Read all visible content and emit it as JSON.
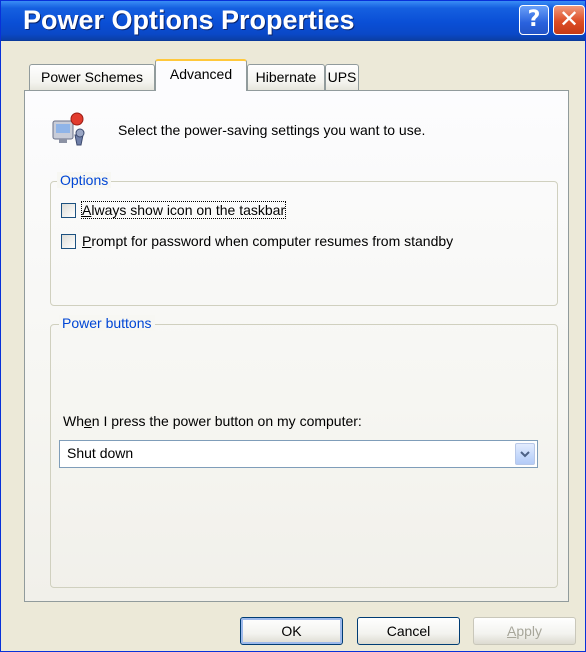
{
  "window": {
    "title": "Power Options Properties",
    "help_icon": "question-mark",
    "close_icon": "x"
  },
  "tabs": [
    {
      "label": "Power Schemes",
      "active": false
    },
    {
      "label": "Advanced",
      "active": true
    },
    {
      "label": "Hibernate",
      "active": false
    },
    {
      "label": "UPS",
      "active": false
    }
  ],
  "intro": {
    "icon": "power-options-icon",
    "text": "Select the power-saving settings you want to use."
  },
  "options_group": {
    "legend": "Options",
    "always_show_icon": {
      "access_key": "A",
      "rest": "lways show icon on the taskbar",
      "checked": false
    },
    "prompt_password": {
      "access_key": "P",
      "rest": "rompt for password when computer resumes from standby",
      "checked": false
    }
  },
  "power_buttons_group": {
    "legend": "Power buttons",
    "dropdown_label_pre": "Wh",
    "dropdown_label_key": "e",
    "dropdown_label_post": "n I press the power button on my computer:",
    "dropdown_value": "Shut down"
  },
  "buttons": {
    "ok": "OK",
    "cancel": "Cancel",
    "apply_key": "A",
    "apply_rest": "pply",
    "apply_enabled": false
  },
  "colors": {
    "titlebar": "#0a4fd6",
    "dialog_bg": "#ece9d8",
    "group_legend": "#0046d5",
    "active_tab_highlight": "#ffc83c"
  }
}
